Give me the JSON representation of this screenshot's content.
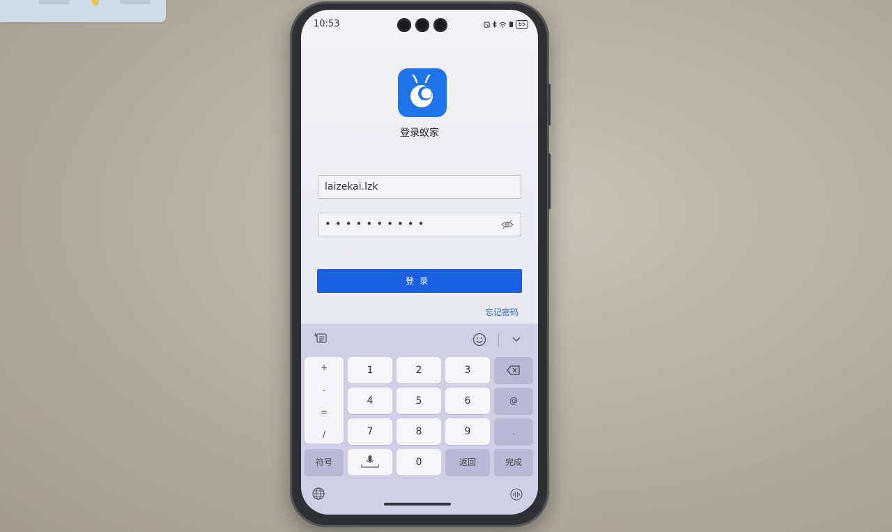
{
  "status_bar": {
    "time": "10:53",
    "battery": "65"
  },
  "app": {
    "title": "登录蚁家"
  },
  "form": {
    "username_value": "laizekai.lzk",
    "password_mask": "••••••••••",
    "login_label": "登录",
    "forgot_label": "忘记密码"
  },
  "keyboard": {
    "symbols": [
      "+",
      "-",
      "=",
      "/"
    ],
    "digits_row1": [
      "1",
      "2",
      "3"
    ],
    "digits_row2": [
      "4",
      "5",
      "6"
    ],
    "digits_row3": [
      "7",
      "8",
      "9"
    ],
    "at_label": "@",
    "dot_label": ".",
    "symbols_label": "符号",
    "zero_label": "0",
    "back_label": "返回",
    "done_label": "完成"
  },
  "colors": {
    "accent": "#1a5fe0",
    "logo_bg": "#1f74ea",
    "link": "#2a62d6"
  },
  "icons": [
    "app-logo-icon",
    "eye-hidden-icon",
    "keyboard-settings-icon",
    "emoji-icon",
    "chevron-down-icon",
    "backspace-icon",
    "microphone-icon",
    "globe-icon",
    "voice-icon"
  ]
}
